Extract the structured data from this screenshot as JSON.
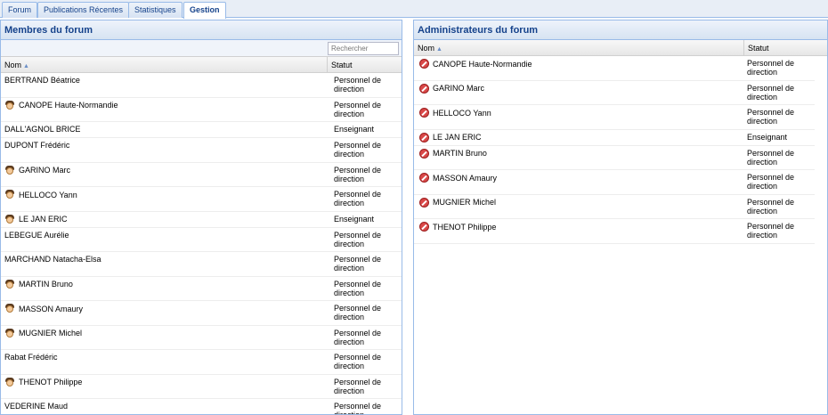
{
  "tabs": [
    "Forum",
    "Publications Récentes",
    "Statistiques",
    "Gestion"
  ],
  "members_panel": {
    "title": "Membres du forum",
    "search_placeholder": "Rechercher",
    "col_nom": "Nom",
    "col_statut": "Statut",
    "rows": [
      {
        "name": "BERTRAND Béatrice",
        "statut": [
          "Personnel de",
          "direction"
        ],
        "icon": false
      },
      {
        "name": "CANOPE Haute-Normandie",
        "statut": [
          "Personnel de",
          "direction"
        ],
        "icon": true
      },
      {
        "name": "DALL'AGNOL BRICE",
        "statut": [
          "Enseignant"
        ],
        "icon": false
      },
      {
        "name": "DUPONT Frédéric",
        "statut": [
          "Personnel de",
          "direction"
        ],
        "icon": false
      },
      {
        "name": "GARINO Marc",
        "statut": [
          "Personnel de",
          "direction"
        ],
        "icon": true
      },
      {
        "name": "HELLOCO Yann",
        "statut": [
          "Personnel de",
          "direction"
        ],
        "icon": true
      },
      {
        "name": "LE JAN ERIC",
        "statut": [
          "Enseignant"
        ],
        "icon": true
      },
      {
        "name": "LEBEGUE Aurélie",
        "statut": [
          "Personnel de",
          "direction"
        ],
        "icon": false
      },
      {
        "name": "MARCHAND Natacha-Elsa",
        "statut": [
          "Personnel de",
          "direction"
        ],
        "icon": false
      },
      {
        "name": "MARTIN Bruno",
        "statut": [
          "Personnel de",
          "direction"
        ],
        "icon": true
      },
      {
        "name": "MASSON Amaury",
        "statut": [
          "Personnel de",
          "direction"
        ],
        "icon": true
      },
      {
        "name": "MUGNIER Michel",
        "statut": [
          "Personnel de",
          "direction"
        ],
        "icon": true
      },
      {
        "name": "Rabat Frédéric",
        "statut": [
          "Personnel de",
          "direction"
        ],
        "icon": false
      },
      {
        "name": "THENOT Philippe",
        "statut": [
          "Personnel de",
          "direction"
        ],
        "icon": true
      },
      {
        "name": "VEDERINE Maud",
        "statut": [
          "Personnel de",
          "direction"
        ],
        "icon": false
      }
    ]
  },
  "admins_panel": {
    "title": "Administrateurs du forum",
    "col_nom": "Nom",
    "col_statut": "Statut",
    "rows": [
      {
        "name": "CANOPE Haute-Normandie",
        "statut": [
          "Personnel de",
          "direction"
        ]
      },
      {
        "name": "GARINO Marc",
        "statut": [
          "Personnel de",
          "direction"
        ]
      },
      {
        "name": "HELLOCO Yann",
        "statut": [
          "Personnel de",
          "direction"
        ]
      },
      {
        "name": "LE JAN ERIC",
        "statut": [
          "Enseignant"
        ]
      },
      {
        "name": "MARTIN Bruno",
        "statut": [
          "Personnel de",
          "direction"
        ]
      },
      {
        "name": "MASSON Amaury",
        "statut": [
          "Personnel de",
          "direction"
        ]
      },
      {
        "name": "MUGNIER Michel",
        "statut": [
          "Personnel de",
          "direction"
        ]
      },
      {
        "name": "THENOT Philippe",
        "statut": [
          "Personnel de",
          "direction"
        ]
      }
    ]
  }
}
